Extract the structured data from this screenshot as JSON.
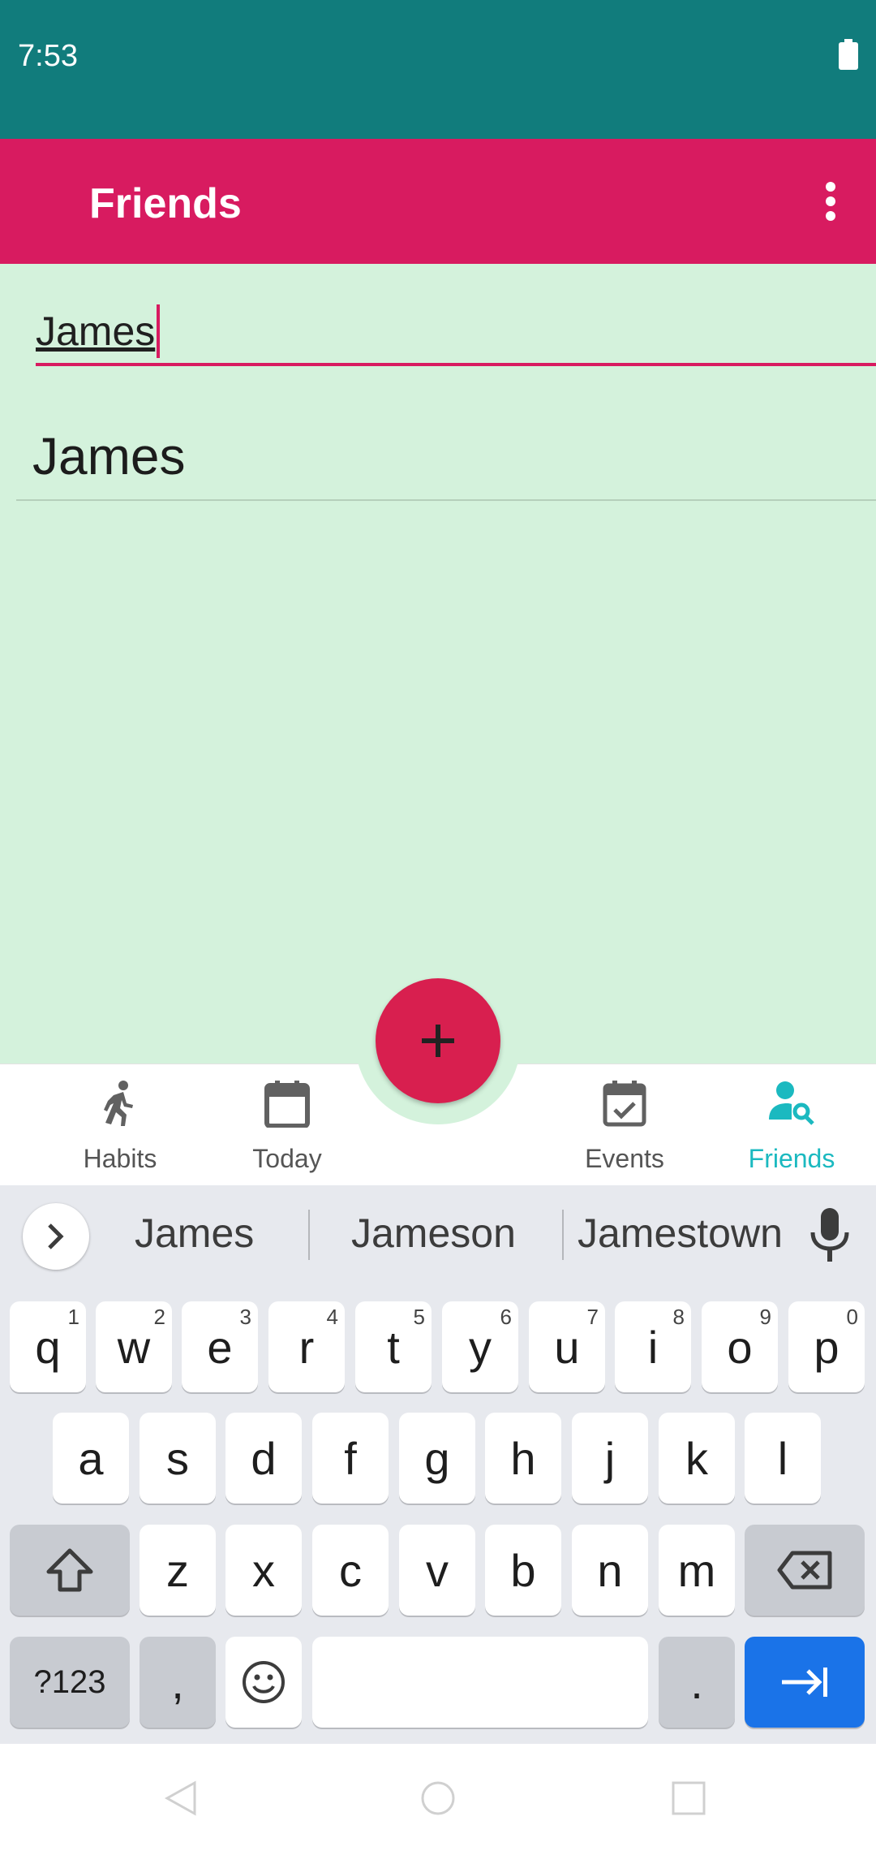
{
  "status_bar": {
    "time": "7:53",
    "battery_icon": "battery-full-icon"
  },
  "app_bar": {
    "title": "Friends",
    "overflow_icon": "more-vert-icon"
  },
  "search": {
    "value": "James"
  },
  "friends_list": [
    {
      "name": "James"
    }
  ],
  "fab": {
    "icon": "plus-icon",
    "color": "#d81f4f"
  },
  "bottom_nav": {
    "items": [
      {
        "label": "Habits",
        "icon": "run-icon"
      },
      {
        "label": "Today",
        "icon": "calendar-icon"
      },
      {
        "label": "Events",
        "icon": "calendar-check-icon"
      },
      {
        "label": "Friends",
        "icon": "person-search-icon"
      }
    ],
    "active": "Friends"
  },
  "keyboard": {
    "suggestions": [
      "James",
      "Jameson",
      "Jamestown"
    ],
    "row1": [
      {
        "key": "q",
        "hint": "1"
      },
      {
        "key": "w",
        "hint": "2"
      },
      {
        "key": "e",
        "hint": "3"
      },
      {
        "key": "r",
        "hint": "4"
      },
      {
        "key": "t",
        "hint": "5"
      },
      {
        "key": "y",
        "hint": "6"
      },
      {
        "key": "u",
        "hint": "7"
      },
      {
        "key": "i",
        "hint": "8"
      },
      {
        "key": "o",
        "hint": "9"
      },
      {
        "key": "p",
        "hint": "0"
      }
    ],
    "row2": [
      "a",
      "s",
      "d",
      "f",
      "g",
      "h",
      "j",
      "k",
      "l"
    ],
    "row3": [
      "z",
      "x",
      "c",
      "v",
      "b",
      "n",
      "m"
    ],
    "symbols_label": "?123",
    "comma_label": ",",
    "period_label": "."
  },
  "colors": {
    "status_bar": "#117c7c",
    "app_bar": "#d81b60",
    "content_bg": "#d4f2dc",
    "accent": "#1bb9c0",
    "enter_key": "#1a73e8"
  }
}
